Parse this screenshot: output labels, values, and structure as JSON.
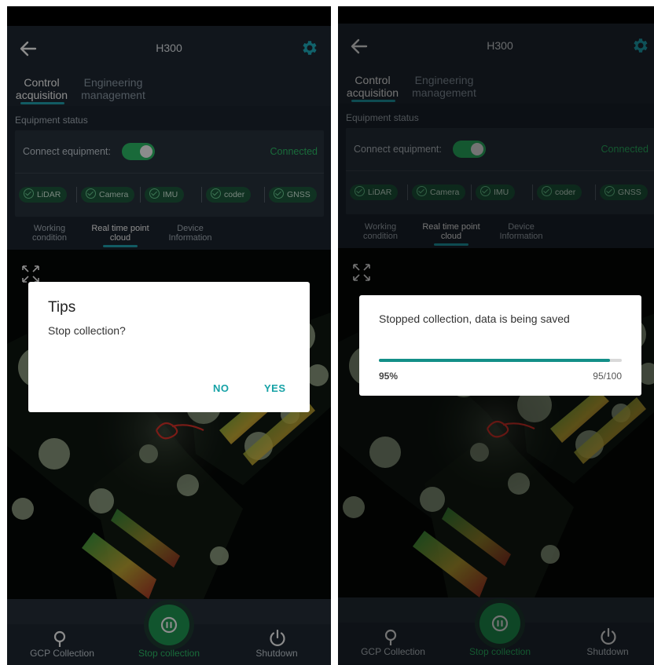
{
  "app": {
    "title": "H300",
    "tabs": [
      {
        "line1": "Control",
        "line2": "acquisition"
      },
      {
        "line1": "Engineering",
        "line2": "management"
      }
    ]
  },
  "equipment": {
    "section_label": "Equipment status",
    "connect_label": "Connect equipment:",
    "connect_state": "Connected",
    "toggle_on": true,
    "chips": [
      "LiDAR",
      "Camera",
      "IMU",
      "coder",
      "GNSS"
    ]
  },
  "subtabs": [
    {
      "line1": "Working",
      "line2": "condition"
    },
    {
      "line1": "Real time point",
      "line2": "cloud"
    },
    {
      "line1": "Device",
      "line2": "Information"
    }
  ],
  "bottom_nav": {
    "gcp": "GCP Collection",
    "stop": "Stop collection",
    "shutdown": "Shutdown"
  },
  "dialog_confirm": {
    "title": "Tips",
    "message": "Stop collection?",
    "no": "NO",
    "yes": "YES"
  },
  "dialog_progress": {
    "message": "Stopped collection, data is being saved",
    "percent_label": "95%",
    "count_label": "95/100",
    "progress": 0.95
  },
  "colors": {
    "accent": "#21a7b4",
    "connected": "#2ec26b",
    "progress": "#138f88",
    "background": "#1c2530"
  }
}
